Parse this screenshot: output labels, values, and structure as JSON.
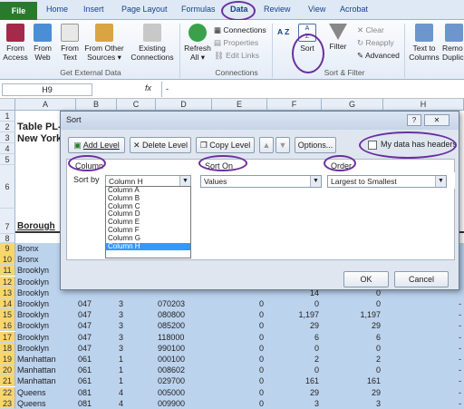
{
  "ribbon_tabs": {
    "file": "File",
    "home": "Home",
    "insert": "Insert",
    "page_layout": "Page Layout",
    "formulas": "Formulas",
    "data": "Data",
    "review": "Review",
    "view": "View",
    "acrobat": "Acrobat"
  },
  "ribbon": {
    "from_access": "From Access",
    "from_web": "From Web",
    "from_text": "From Text",
    "from_other": "From Other Sources ▾",
    "existing": "Existing Connections",
    "group_external": "Get External Data",
    "refresh": "Refresh All ▾",
    "connections": "Connections",
    "properties": "Properties",
    "edit_links": "Edit Links",
    "group_connections": "Connections",
    "sort_az": "A Z",
    "sort": "Sort",
    "filter": "Filter",
    "clear": "Clear",
    "reapply": "Reapply",
    "advanced": "Advanced",
    "group_sort": "Sort & Filter",
    "text_to_columns": "Text to Columns",
    "remove_dup": "Remo Duplic"
  },
  "formula_bar": {
    "name_box": "H9",
    "fx": "fx",
    "content": "-"
  },
  "columns": [
    "A",
    "B",
    "C",
    "D",
    "E",
    "F",
    "G",
    "H"
  ],
  "rows": [
    "1",
    "2",
    "3",
    "4",
    "5",
    "6",
    "7",
    "8",
    "9",
    "10",
    "11",
    "12",
    "13",
    "14",
    "15",
    "16",
    "17",
    "18",
    "19",
    "20",
    "21",
    "22",
    "23"
  ],
  "sheet": {
    "title1": "Table PL-",
    "title2": "New York",
    "borough_header": "Borough",
    "data_rows": [
      {
        "a": "Bronx",
        "b": "",
        "c": "",
        "d": "",
        "e": "",
        "f": "",
        "g": "",
        "h": ""
      },
      {
        "a": "Bronx",
        "b": "",
        "c": "",
        "d": "",
        "e": "",
        "f": "",
        "g": "",
        "h": ""
      },
      {
        "a": "Brooklyn",
        "b": "",
        "c": "",
        "d": "",
        "e": "",
        "f": "",
        "g": "",
        "h": ""
      },
      {
        "a": "Brooklyn",
        "b": "",
        "c": "",
        "d": "",
        "e": "",
        "f": "",
        "g": "",
        "h": ""
      },
      {
        "a": "Brooklyn",
        "b": "",
        "c": "",
        "d": "",
        "e": "",
        "f": "",
        "g": "",
        "h": ""
      },
      {
        "a": "Brooklyn",
        "b": "047",
        "c": "3",
        "d": "070203",
        "e": "0",
        "f": "0",
        "g": "0",
        "h": "-"
      },
      {
        "a": "Brooklyn",
        "b": "047",
        "c": "3",
        "d": "080800",
        "e": "0",
        "f": "1,197",
        "g": "1,197",
        "h": "-"
      },
      {
        "a": "Brooklyn",
        "b": "047",
        "c": "3",
        "d": "085200",
        "e": "0",
        "f": "29",
        "g": "29",
        "h": "-"
      },
      {
        "a": "Brooklyn",
        "b": "047",
        "c": "3",
        "d": "118000",
        "e": "0",
        "f": "6",
        "g": "6",
        "h": "-"
      },
      {
        "a": "Brooklyn",
        "b": "047",
        "c": "3",
        "d": "990100",
        "e": "0",
        "f": "0",
        "g": "0",
        "h": "-"
      },
      {
        "a": "Manhattan",
        "b": "061",
        "c": "1",
        "d": "000100",
        "e": "0",
        "f": "2",
        "g": "2",
        "h": "-"
      },
      {
        "a": "Manhattan",
        "b": "061",
        "c": "1",
        "d": "008602",
        "e": "0",
        "f": "0",
        "g": "0",
        "h": "-"
      },
      {
        "a": "Manhattan",
        "b": "061",
        "c": "1",
        "d": "029700",
        "e": "0",
        "f": "161",
        "g": "161",
        "h": "-"
      },
      {
        "a": "Queens",
        "b": "081",
        "c": "4",
        "d": "005000",
        "e": "0",
        "f": "29",
        "g": "29",
        "h": "-"
      },
      {
        "a": "Queens",
        "b": "081",
        "c": "4",
        "d": "009900",
        "e": "0",
        "f": "3",
        "g": "3",
        "h": "-"
      }
    ],
    "partial_row13": {
      "f": "14",
      "g": "0"
    }
  },
  "dialog": {
    "title": "Sort",
    "help": "?",
    "close": "✕",
    "add_level": "Add Level",
    "delete_level": "Delete Level",
    "copy_level": "Copy Level",
    "up": "▲",
    "down": "▼",
    "options": "Options...",
    "headers_label": "My data has headers",
    "column_header": "Column",
    "sort_on_header": "Sort On",
    "order_header": "Order",
    "sort_by": "Sort by",
    "column_value": "Column H",
    "sort_on_value": "Values",
    "order_value": "Largest to Smallest",
    "dropdown_items": [
      "Column A",
      "Column B",
      "Column C",
      "Column D",
      "Column E",
      "Column F",
      "Column G",
      "Column H"
    ],
    "ok": "OK",
    "cancel": "Cancel"
  },
  "colors": {
    "accent_circle": "#6b2f9e",
    "selection": "#bcd3ee",
    "file_tab": "#2a7a2e"
  }
}
